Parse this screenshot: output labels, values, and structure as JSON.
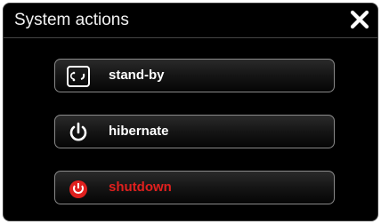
{
  "dialog": {
    "title": "System actions",
    "close_icon": "close-icon"
  },
  "actions": [
    {
      "label": "stand-by",
      "icon": "standby-icon"
    },
    {
      "label": "hibernate",
      "icon": "power-icon"
    },
    {
      "label": "shutdown",
      "icon": "shutdown-icon",
      "color": "#e0201e"
    }
  ]
}
